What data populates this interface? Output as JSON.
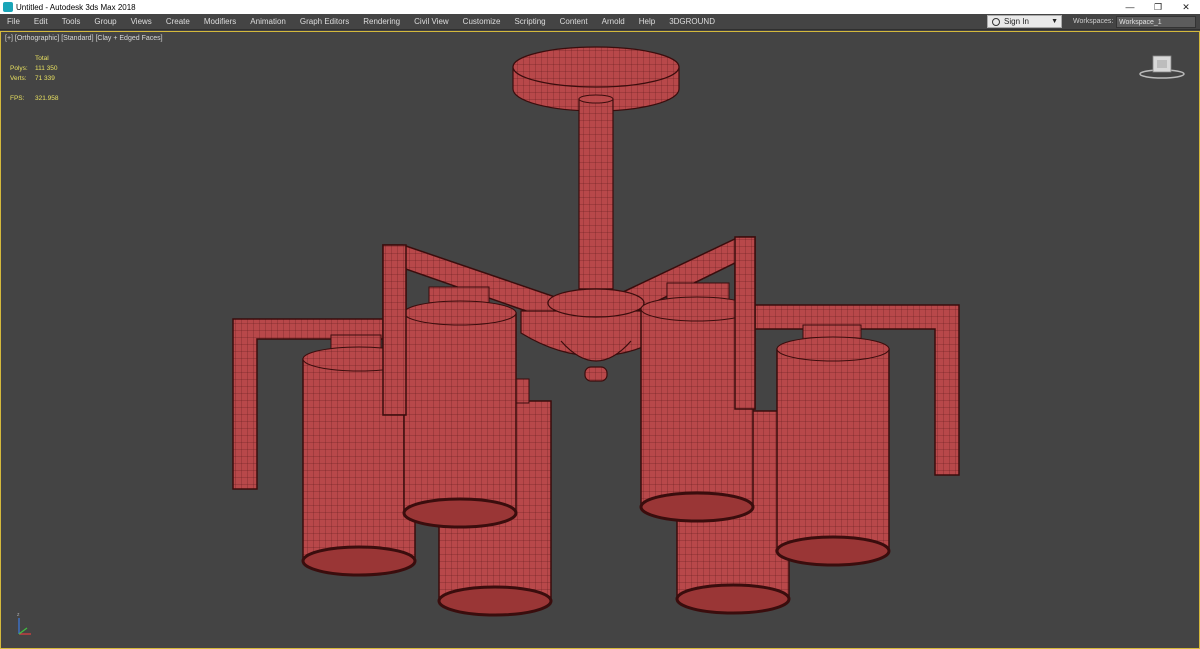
{
  "window": {
    "title": "Untitled - Autodesk 3ds Max 2018",
    "minimize_glyph": "—",
    "restore_glyph": "❐",
    "close_glyph": "✕"
  },
  "menu": {
    "items": [
      "File",
      "Edit",
      "Tools",
      "Group",
      "Views",
      "Create",
      "Modifiers",
      "Animation",
      "Graph Editors",
      "Rendering",
      "Civil View",
      "Customize",
      "Scripting",
      "Content",
      "Arnold",
      "Help",
      "3DGROUND"
    ],
    "sign_in": "Sign In",
    "workspaces_label": "Workspaces:",
    "workspace_value": "Workspace_1"
  },
  "viewport": {
    "label": "[+] [Orthographic] [Standard] [Clay + Edged Faces]",
    "stats": {
      "header": "Total",
      "polys_label": "Polys:",
      "polys_value": "111 350",
      "verts_label": "Verts:",
      "verts_value": "71 339",
      "fps_label": "FPS:",
      "fps_value": "321.958"
    }
  },
  "colors": {
    "model_fill": "#b8484a",
    "model_edge": "#3a0d0d",
    "viewport_bg": "#444444",
    "viewport_border": "#d4b93c",
    "stats_text": "#e8e060"
  }
}
